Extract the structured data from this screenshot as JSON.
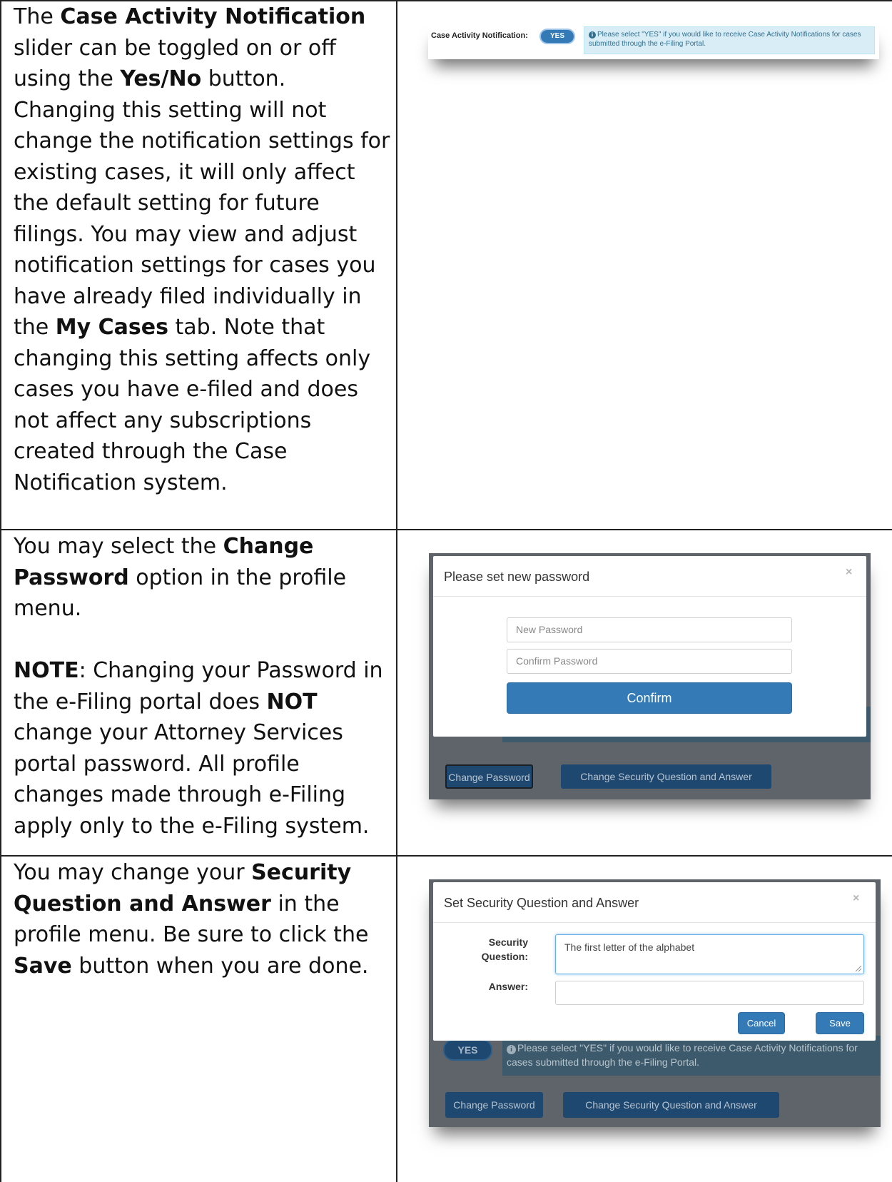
{
  "rows": [
    {
      "text_parts": [
        {
          "t": "The "
        },
        {
          "t": "Case Activity Notification",
          "b": true
        },
        {
          "t": " slider can be toggled on or off using the "
        },
        {
          "t": "Yes/No",
          "b": true
        },
        {
          "t": " button. Changing this setting will not change the notification settings for existing cases, it will only affect the default setting for future filings. You may view and adjust notification settings for cases you have already filed individually in the "
        },
        {
          "t": "My Cases",
          "b": true
        },
        {
          "t": " tab. Note that changing this setting affects only cases you have e-filed and does not affect any subscriptions created through the Case Notification system."
        }
      ]
    },
    {
      "text_parts": [
        {
          "t": "You may select the "
        },
        {
          "t": "Change Password",
          "b": true
        },
        {
          "t": " option in the profile menu."
        }
      ],
      "note_parts": [
        {
          "t": "NOTE",
          "b": true
        },
        {
          "t": ": Changing your Password in the e-Filing portal does "
        },
        {
          "t": "NOT",
          "b": true
        },
        {
          "t": " change your Attorney Services portal password. All profile changes made through e-Filing apply only to the e-Filing system."
        }
      ]
    },
    {
      "text_parts": [
        {
          "t": "You may change your "
        },
        {
          "t": "Security Question and Answer",
          "b": true
        },
        {
          "t": " in the profile menu. Be sure to click the "
        },
        {
          "t": "Save",
          "b": true
        },
        {
          "t": " button when you are done."
        }
      ]
    }
  ],
  "shot1": {
    "label": "Case Activity Notification:",
    "toggle": "YES",
    "info_icon": "i",
    "info_text": "Please select \"YES\" if you would like to receive Case Activity Notifications for cases submitted through the e-Filing Portal."
  },
  "shot2": {
    "title": "Please set new password",
    "close": "×",
    "new_password_placeholder": "New Password",
    "confirm_password_placeholder": "Confirm Password",
    "confirm": "Confirm",
    "btn_change_password": "Change Password",
    "btn_change_security": "Change Security Question and Answer"
  },
  "shot3": {
    "title": "Set Security Question and Answer",
    "close": "×",
    "security_question_label": "Security Question:",
    "security_question_value": "The first letter of the alphabet",
    "answer_label": "Answer:",
    "answer_value": "",
    "cancel": "Cancel",
    "save": "Save",
    "toggle": "YES",
    "info_icon": "i",
    "info_text": "Please select \"YES\" if you would like to receive Case Activity Notifications for cases submitted through the e-Filing Portal.",
    "btn_change_password": "Change Password",
    "btn_change_security": "Change Security Question and Answer"
  },
  "colors": {
    "primary": "#337ab7",
    "info_bg": "#d9edf7",
    "info_text": "#31708f",
    "overlay": "#5f646a"
  }
}
